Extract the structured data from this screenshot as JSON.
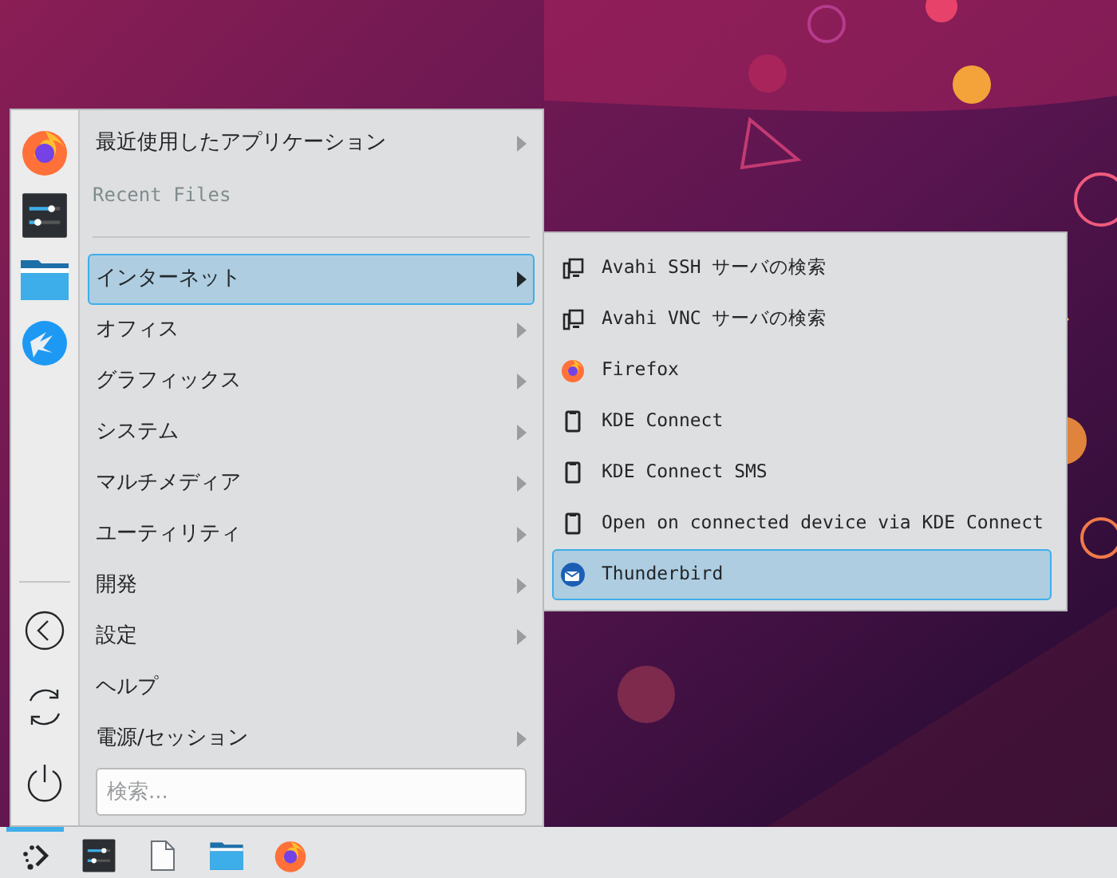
{
  "menu": {
    "items": [
      {
        "label": "最近使用したアプリケーション",
        "kind": "submenu",
        "selected": false
      },
      {
        "label": "Recent Files",
        "kind": "header"
      },
      {
        "kind": "separator"
      },
      {
        "label": "インターネット",
        "kind": "submenu",
        "selected": true
      },
      {
        "label": "オフィス",
        "kind": "submenu",
        "selected": false
      },
      {
        "label": "グラフィックス",
        "kind": "submenu",
        "selected": false
      },
      {
        "label": "システム",
        "kind": "submenu",
        "selected": false
      },
      {
        "label": "マルチメディア",
        "kind": "submenu",
        "selected": false
      },
      {
        "label": "ユーティリティ",
        "kind": "submenu",
        "selected": false
      },
      {
        "label": "開発",
        "kind": "submenu",
        "selected": false
      },
      {
        "label": "設定",
        "kind": "submenu",
        "selected": false
      },
      {
        "label": "ヘルプ",
        "kind": "action",
        "selected": false
      },
      {
        "label": "電源/セッション",
        "kind": "submenu",
        "selected": false
      }
    ],
    "search": {
      "placeholder": "検索..."
    }
  },
  "submenu": {
    "items": [
      {
        "label": "Avahi SSH サーバの検索",
        "kind": "network",
        "selected": false
      },
      {
        "label": "Avahi VNC サーバの検索",
        "kind": "network",
        "selected": false
      },
      {
        "label": "Firefox",
        "kind": "firefox",
        "selected": false
      },
      {
        "label": "KDE Connect",
        "kind": "phone",
        "selected": false
      },
      {
        "label": "KDE Connect SMS",
        "kind": "phone",
        "selected": false
      },
      {
        "label": "Open on connected device via KDE Connect",
        "kind": "phone",
        "selected": false
      },
      {
        "label": "Thunderbird",
        "kind": "thunderbird",
        "selected": true
      }
    ]
  },
  "taskbar": {
    "items": [
      {
        "kind": "launcher",
        "selected": true
      },
      {
        "kind": "mixer",
        "selected": false
      },
      {
        "kind": "document",
        "selected": false
      },
      {
        "kind": "folder",
        "selected": false
      },
      {
        "kind": "firefox",
        "selected": false
      }
    ]
  }
}
